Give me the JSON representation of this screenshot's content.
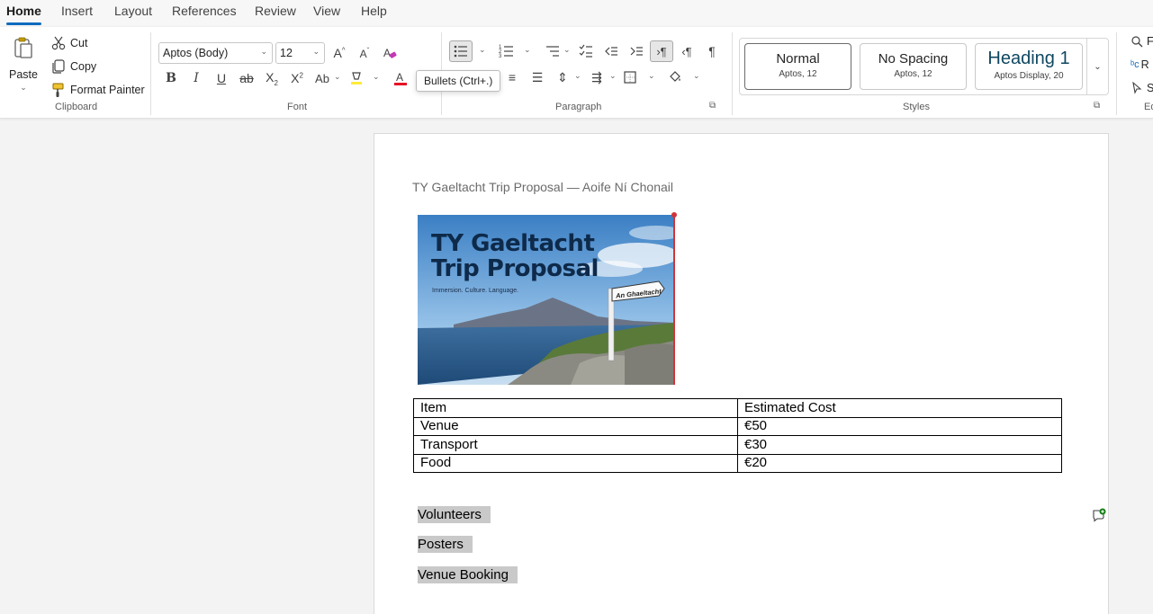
{
  "tabs": [
    {
      "label": "Home",
      "active": true
    },
    {
      "label": "Insert"
    },
    {
      "label": "Layout"
    },
    {
      "label": "References"
    },
    {
      "label": "Review"
    },
    {
      "label": "View"
    },
    {
      "label": "Help"
    }
  ],
  "clipboard": {
    "paste": "Paste",
    "cut": "Cut",
    "copy": "Copy",
    "format_painter": "Format Painter",
    "label": "Clipboard"
  },
  "font": {
    "family": "Aptos (Body)",
    "size": "12",
    "label": "Font",
    "color_accent": "#e81123"
  },
  "paragraph": {
    "label": "Paragraph"
  },
  "styles": {
    "label": "Styles",
    "items": [
      {
        "name": "Normal",
        "sub": "Aptos, 12"
      },
      {
        "name": "No Spacing",
        "sub": "Aptos, 12"
      },
      {
        "name": "Heading 1",
        "sub": "Aptos Display, 20"
      }
    ]
  },
  "editing": {
    "label": "Ed"
  },
  "tooltip": "Bullets (Ctrl+.)",
  "document": {
    "header": "TY Gaeltacht Trip Proposal — Aoife Ní Chonail",
    "image": {
      "title_line1": "TY Gaeltacht",
      "title_line2": "Trip Proposal",
      "subtitle": "Immersion. Culture. Language.",
      "sign": "An Ghaeltacht"
    },
    "table": {
      "headers": [
        "Item",
        "Estimated Cost"
      ],
      "rows": [
        [
          "Venue",
          "€50"
        ],
        [
          "Transport",
          "€30"
        ],
        [
          "Food",
          "€20"
        ]
      ]
    },
    "paragraphs": [
      "Volunteers",
      "Posters",
      "Venue Booking"
    ]
  }
}
